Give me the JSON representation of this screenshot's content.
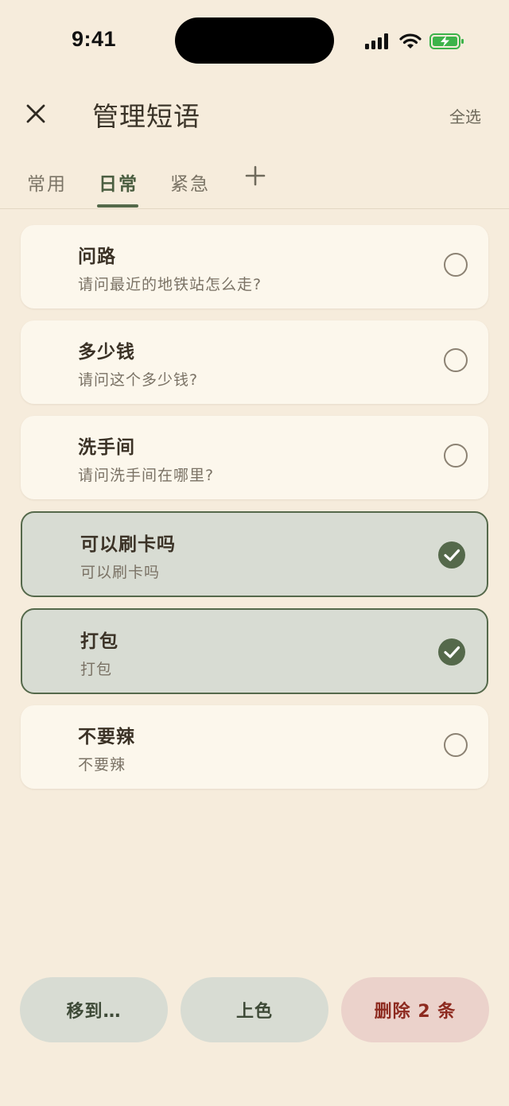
{
  "status_bar": {
    "time": "9:41"
  },
  "header": {
    "title": "管理短语",
    "select_all": "全选"
  },
  "tabs": [
    {
      "label": "常用",
      "active": false
    },
    {
      "label": "日常",
      "active": true
    },
    {
      "label": "紧急",
      "active": false
    }
  ],
  "phrases": [
    {
      "title": "问路",
      "subtitle": "请问最近的地铁站怎么走?",
      "selected": false
    },
    {
      "title": "多少钱",
      "subtitle": "请问这个多少钱?",
      "selected": false
    },
    {
      "title": "洗手间",
      "subtitle": "请问洗手间在哪里?",
      "selected": false
    },
    {
      "title": "可以刷卡吗",
      "subtitle": "可以刷卡吗",
      "selected": true
    },
    {
      "title": "打包",
      "subtitle": "打包",
      "selected": true
    },
    {
      "title": "不要辣",
      "subtitle": "不要辣",
      "selected": false
    }
  ],
  "actions": {
    "move_label": "移到…",
    "color_label": "上色",
    "delete_label": "删除 2 条"
  },
  "colors": {
    "background": "#f6ecdc",
    "card": "#fcf7ec",
    "selected_card": "#d8dcd3",
    "accent": "#54694a",
    "danger_text": "#8d2a1f",
    "danger_bg": "#ebd2cb"
  },
  "icons": {
    "close": "close-icon",
    "add_tab": "plus-icon",
    "unchecked": "radio-empty-icon",
    "checked": "check-circle-icon"
  }
}
